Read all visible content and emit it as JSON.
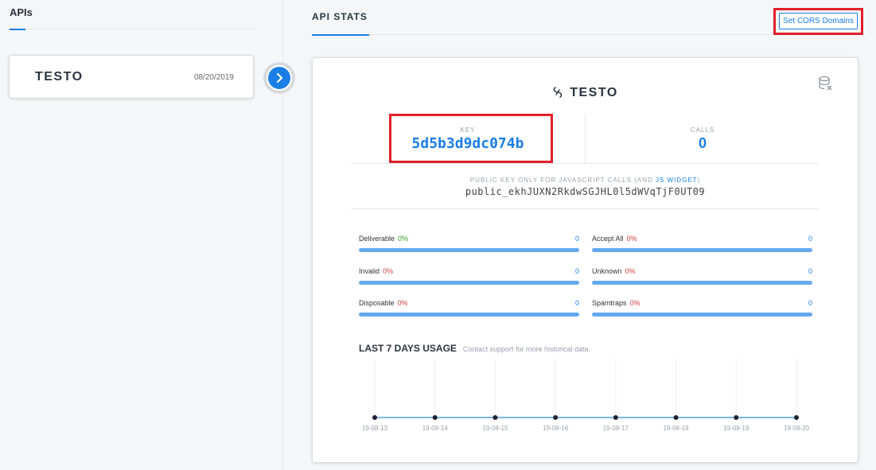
{
  "sidebar": {
    "title": "APIs",
    "apis": [
      {
        "name": "TESTO",
        "date": "08/20/2019"
      }
    ]
  },
  "header": {
    "tab": "API STATS",
    "cors_button": "Set CORS Domains"
  },
  "card": {
    "title": "TESTO",
    "key_label": "KEY",
    "key_value": "5d5b3d9dc074b",
    "calls_label": "CALLS",
    "calls_value": "0",
    "public_key_label_prefix": "PUBLIC KEY ONLY FOR JAVASCRIPT CALLS (AND ",
    "public_key_label_link": "JS WIDGET",
    "public_key_label_suffix": ")",
    "public_key": "public_ekhJUXN2RkdwSGJHL0l5dWVqTjF0UT09",
    "stats": [
      {
        "name": "Deliverable",
        "pct": "0%",
        "count": "0",
        "pct_color": "green"
      },
      {
        "name": "Accept All",
        "pct": "0%",
        "count": "0",
        "pct_color": "red"
      },
      {
        "name": "Invalid",
        "pct": "0%",
        "count": "0",
        "pct_color": "red"
      },
      {
        "name": "Unknown",
        "pct": "0%",
        "count": "0",
        "pct_color": "red"
      },
      {
        "name": "Disposable",
        "pct": "0%",
        "count": "0",
        "pct_color": "red"
      },
      {
        "name": "Spamtraps",
        "pct": "0%",
        "count": "0",
        "pct_color": "red"
      }
    ],
    "usage_title": "LAST 7 DAYS USAGE",
    "usage_note": "Contact support for more historical data."
  },
  "chart_data": {
    "type": "line",
    "x": [
      "19-08-13",
      "19-08-14",
      "19-08-15",
      "19-08-16",
      "19-08-17",
      "19-08-18",
      "19-08-19",
      "19-08-20"
    ],
    "series": [
      {
        "values": [
          0,
          0,
          0,
          0,
          0,
          0,
          0,
          0
        ]
      }
    ],
    "title": "LAST 7 DAYS USAGE",
    "xlabel": "",
    "ylabel": "",
    "grid": true
  },
  "colors": {
    "accent": "#1a7ee6",
    "highlight": "#e0202a",
    "bar": "#64a9ee",
    "pct_green": "#3a9a2a",
    "pct_red": "#d23c3c"
  }
}
